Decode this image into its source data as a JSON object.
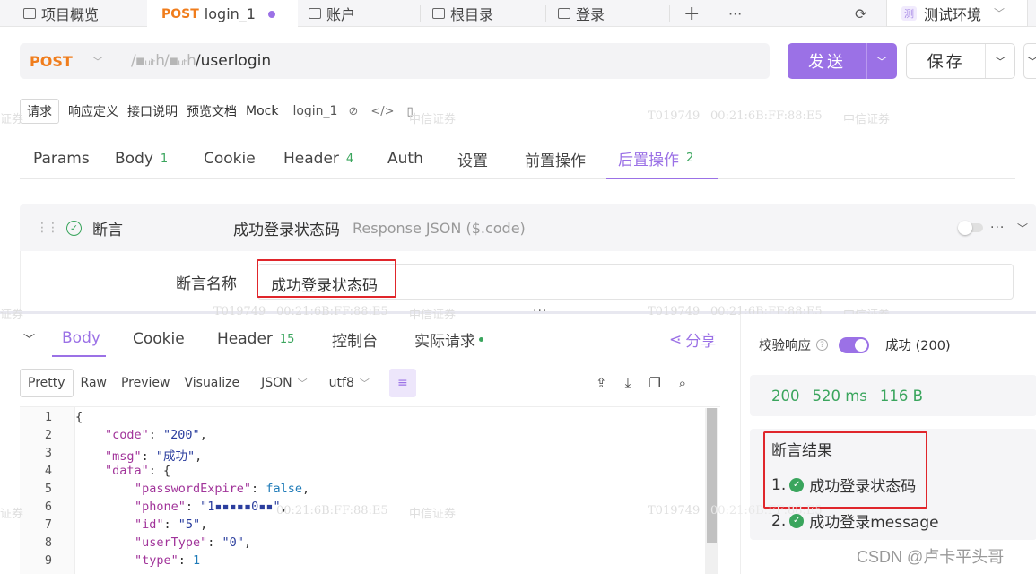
{
  "tabs": [
    {
      "label": "项目概览",
      "icon": "grid-icon"
    },
    {
      "method": "POST",
      "label": "login_1",
      "active": true
    },
    {
      "label": "账户",
      "icon": "folder-icon"
    },
    {
      "label": "根目录",
      "icon": "folder-icon"
    },
    {
      "label": "登录",
      "icon": "folder-icon"
    }
  ],
  "tab_add": "+",
  "tab_more": "···",
  "env": {
    "badge": "测",
    "label": "测试环境"
  },
  "request": {
    "method": "POST",
    "url_blurred": "/▪ᵤᵢₜh/▪ᵤₜh",
    "url_path": "/userlogin",
    "send_label": "发送",
    "save_label": "保存"
  },
  "doc_tabs": [
    "请求",
    "响应定义",
    "接口说明",
    "预览文档",
    "Mock"
  ],
  "doc_name": "login_1",
  "watermark": {
    "code": "T019749",
    "mac": "00:21:6B:FF:88:E5",
    "company": "中信证券",
    "frag": "证券"
  },
  "param_tabs": [
    {
      "label": "Params"
    },
    {
      "label": "Body",
      "count": "1"
    },
    {
      "label": "Cookie"
    },
    {
      "label": "Header",
      "count": "4"
    },
    {
      "label": "Auth"
    },
    {
      "label": "设置"
    },
    {
      "label": "前置操作"
    },
    {
      "label": "后置操作",
      "count": "2",
      "active": true
    }
  ],
  "assertion": {
    "title": "断言",
    "name": "成功登录状态码",
    "source": "Response JSON ($.code)",
    "name_label": "断言名称",
    "name_value": "成功登录状态码"
  },
  "response_tabs": [
    {
      "label": "Body",
      "active": true
    },
    {
      "label": "Cookie"
    },
    {
      "label": "Header",
      "count": "15"
    },
    {
      "label": "控制台"
    },
    {
      "label": "实际请求"
    }
  ],
  "share_label": "分享",
  "view_modes": [
    "Pretty",
    "Raw",
    "Preview",
    "Visualize"
  ],
  "format": "JSON",
  "encoding": "utf8",
  "code_lines": [
    "1",
    "2",
    "3",
    "4",
    "5",
    "6",
    "7",
    "8",
    "9"
  ],
  "json": {
    "code": "\"200\"",
    "msg": "\"成功\"",
    "passwordExpire": "false",
    "phone": "\"1▪▪▪▪▪0▪▪\"",
    "id": "\"5\"",
    "userType": "\"0\"",
    "type": "1"
  },
  "side": {
    "validate_label": "校验响应",
    "status": "成功 (200)",
    "status_code": "200",
    "time": "520 ms",
    "size": "116 B",
    "results_title": "断言结果",
    "results": [
      {
        "index": "1.",
        "label": "成功登录状态码"
      },
      {
        "index": "2.",
        "label": "成功登录message"
      }
    ]
  },
  "credit": "CSDN @卢卡平头哥",
  "colors": {
    "accent": "#9b71e6",
    "post": "#f07d1c",
    "success": "#3aa55d",
    "highlight": "#e0262b"
  }
}
